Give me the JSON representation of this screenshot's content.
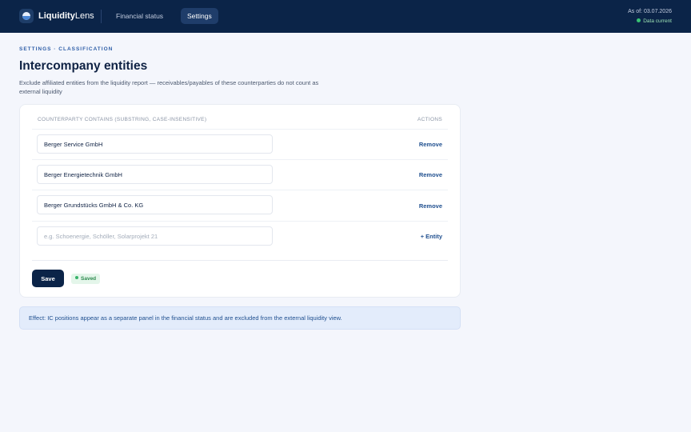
{
  "header": {
    "brand_bold": "Liquidity",
    "brand_light": "Lens",
    "nav": [
      {
        "label": "Financial status",
        "active": false
      },
      {
        "label": "Settings",
        "active": true
      }
    ],
    "as_of": "As of: 03.07.2026",
    "status": "Data current",
    "status_color": "#38c173"
  },
  "page": {
    "breadcrumb": "SETTINGS · CLASSIFICATION",
    "title": "Intercompany entities",
    "description": "Exclude affiliated entities from the liquidity report — receivables/payables of these counterparties do not count as external liquidity"
  },
  "table": {
    "col_left": "COUNTERPARTY CONTAINS (SUBSTRING, CASE-INSENSITIVE)",
    "col_right": "ACTIONS",
    "rows": [
      {
        "value": "Berger Service GmbH",
        "action": "Remove"
      },
      {
        "value": "Berger Energietechnik GmbH",
        "action": "Remove"
      },
      {
        "value": "Berger Grundstücks GmbH & Co. KG",
        "action": "Remove"
      }
    ],
    "new_row": {
      "placeholder": "e.g. Schoenergie, Schöller, Solarprojekt 21",
      "action": "+ Entity"
    }
  },
  "footer": {
    "save_label": "Save",
    "saved_label": "Saved"
  },
  "info": "Effect: IC positions appear as a separate panel in the financial status and are excluded from the external liquidity view.",
  "colors": {
    "navy": "#0b2448",
    "accent": "#1f4f8f",
    "success": "#38b36a"
  }
}
